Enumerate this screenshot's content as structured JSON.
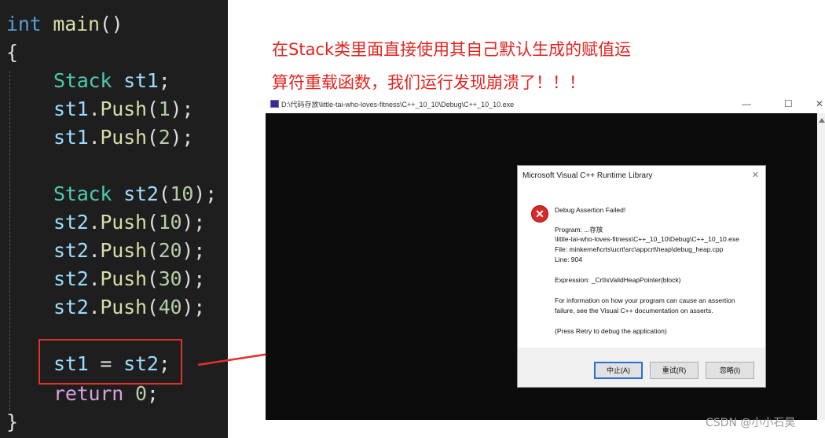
{
  "code": {
    "line1": {
      "kw": "int",
      "fn": "main",
      "rest": "()"
    },
    "line2": "{",
    "line3": {
      "type": "Stack",
      "var": "st1",
      "end": ";"
    },
    "line4": {
      "obj": "st1",
      "dot": ".",
      "fn": "Push",
      "open": "(",
      "arg": "1",
      "close": ");"
    },
    "line5": {
      "obj": "st1",
      "dot": ".",
      "fn": "Push",
      "open": "(",
      "arg": "2",
      "close": ");"
    },
    "line7": {
      "type": "Stack",
      "var": "st2",
      "open": "(",
      "arg": "10",
      "close": ");"
    },
    "line8": {
      "obj": "st2",
      "dot": ".",
      "fn": "Push",
      "open": "(",
      "arg": "10",
      "close": ");"
    },
    "line9": {
      "obj": "st2",
      "dot": ".",
      "fn": "Push",
      "open": "(",
      "arg": "20",
      "close": ");"
    },
    "line10": {
      "obj": "st2",
      "dot": ".",
      "fn": "Push",
      "open": "(",
      "arg": "30",
      "close": ");"
    },
    "line11": {
      "obj": "st2",
      "dot": ".",
      "fn": "Push",
      "open": "(",
      "arg": "40",
      "close": ");"
    },
    "line13": {
      "lhs": "st1",
      "op": " = ",
      "rhs": "st2",
      "end": ";"
    },
    "line14": {
      "kw": "return",
      "sp": " ",
      "num": "0",
      "end": ";"
    },
    "line15": "}"
  },
  "annotation": {
    "line1": "在Stack类里面直接使用其自己默认生成的赋值运",
    "line2": "算符重载函数，我们运行发现崩溃了！！！"
  },
  "console": {
    "title": "D:\\代码存放\\little-tai-who-loves-fitness\\C++_10_10\\Debug\\C++_10_10.exe",
    "minimize": "—",
    "maximize": "☐",
    "close": "✕"
  },
  "dialog": {
    "title": "Microsoft Visual C++ Runtime Library",
    "close": "✕",
    "heading": "Debug Assertion Failed!",
    "program_label": "Program: ...存放",
    "program_path": "\\little-tai-who-loves-fitness\\C++_10_10\\Debug\\C++_10_10.exe",
    "file": "File: minkernel\\crts\\ucrt\\src\\appcrt\\heap\\debug_heap.cpp",
    "line": "Line: 904",
    "expression": "Expression: _CrtIsValidHeapPointer(block)",
    "info1": "For information on how your program can cause an assertion",
    "info2": "failure, see the Visual C++ documentation on asserts.",
    "hint": "(Press Retry to debug the application)",
    "buttons": {
      "abort": "中止(A)",
      "retry": "重试(R)",
      "ignore": "忽略(I)"
    },
    "icon": "error-icon"
  },
  "watermark": "CSDN @小小石昊",
  "colors": {
    "annotation": "#e3241f",
    "highlight": "#e0312a",
    "editor_bg": "#1e1e1e"
  }
}
